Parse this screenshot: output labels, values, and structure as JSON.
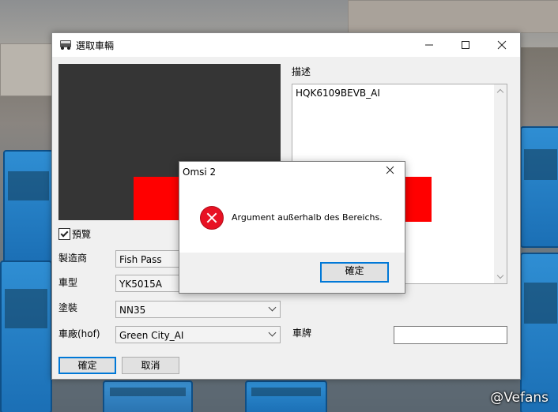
{
  "window": {
    "title": "選取車輛",
    "minimize_icon": "minimize-icon",
    "maximize_icon": "maximize-icon",
    "close_icon": "close-icon"
  },
  "preview_checkbox": {
    "label": "預覽",
    "checked": true
  },
  "form": {
    "manufacturer_label": "製造商",
    "manufacturer_value": "Fish Pass",
    "model_label": "車型",
    "model_value": "YK5015A",
    "livery_label": "塗裝",
    "livery_value": "NN35",
    "depot_label": "車廠(hof)",
    "depot_value": "Green City_AI",
    "plate_label": "車牌",
    "plate_value": ""
  },
  "description": {
    "label": "描述",
    "text": "HQK6109BEVB_AI"
  },
  "buttons": {
    "ok": "確定",
    "cancel": "取消"
  },
  "error_dialog": {
    "title": "Omsi 2",
    "message": "Argument außerhalb des Bereichs.",
    "ok": "確定",
    "icon": "error-icon"
  },
  "watermark": "@Vefans",
  "colors": {
    "accent": "#0078d7",
    "error": "#e81123",
    "preview_red": "#ff0000"
  }
}
